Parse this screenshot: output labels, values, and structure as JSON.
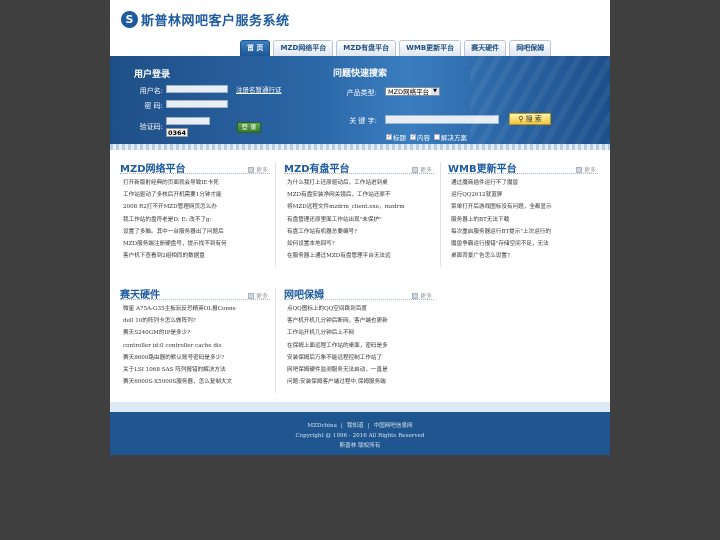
{
  "brand": {
    "logo_glyph": "S",
    "title": "斯普林网吧客户服务系统",
    "color": "#1d5a9e"
  },
  "nav": {
    "tabs": [
      {
        "label": "首 页"
      },
      {
        "label": "MZD网络平台"
      },
      {
        "label": "MZD有盘平台"
      },
      {
        "label": "WMB更新平台"
      },
      {
        "label": "赛天硬件"
      },
      {
        "label": "网吧保姆"
      }
    ],
    "active_index": 0
  },
  "login": {
    "title": "用户登录",
    "username_label": "用户名:",
    "password_label": "密  码:",
    "captcha_label": "验证码:",
    "register_link": "注册名暂通行证",
    "captcha_text": "0364",
    "submit_label": "登 录"
  },
  "quick_search": {
    "title": "问题快速搜索",
    "product_label": "产品类型:",
    "product_selected": "MZD网络平台",
    "keyword_label": "关 键 字:",
    "search_button": "搜 索",
    "options": [
      {
        "label": "标题",
        "checked": true
      },
      {
        "label": "内容",
        "checked": true
      },
      {
        "label": "解决方案",
        "checked": false
      }
    ]
  },
  "sections": [
    {
      "title": "MZD网络平台",
      "more": "更多",
      "items": [
        "打开新版射经典的页面就会导致IE卡死",
        "工作站驱动了多核后开机需要1分钟才能",
        "2008 R2打不开MZD管理网页怎么办",
        "我工作站的盘符老是D: E: 改不了g:",
        "设置了多脑。其中一台服务器出了问题后",
        "MZD服务端注册硬盘号，提示找不到有何",
        "客户机下查看到2组相同的数据盘"
      ]
    },
    {
      "title": "MZD有盘平台",
      "more": "更多",
      "items": [
        "为什么我打上还原驱动后，工作站进到桌",
        "MZD有盘安装净网关镜后，工作站还原不",
        "将MZD远程文件mzdrm_client.exe，mzdrm",
        "有盘管理还原里面工作站出现\"未保护\"",
        "有盘工作站有机器总要编号?",
        "如何设置本地回写?",
        "在服务器上通过MZD有盘管理平台无法远"
      ]
    },
    {
      "title": "WMB更新平台",
      "more": "更多",
      "items": [
        "通过魔商插件运行不了魔兽",
        "运行QQ2012就蓝屏",
        "菜单打开后游戏图标没有问题，全都显示",
        "服务器上的BT无法下载",
        "每次重启服务器运行BT提示\"上次运行的",
        "魔兽争霸运行报错\"存储空间不足，无法",
        "桌面背景广告怎么设置?"
      ]
    },
    {
      "title": "赛天硬件",
      "more": "更多",
      "items": [
        "微星 A75A-G35主板玩反恐精英OL报Conne",
        "dell 10的阵列卡怎么做阵列?",
        "赛天S240GM的IP是多少?",
        "controller id:0 controller cache dis",
        "赛天8600路由器的默认账号密码是多少?",
        "关于LSI 1068 SAS 阵列报错的解决方法",
        "赛天6000S-X5000S服务器，怎么复制大文"
      ]
    },
    {
      "title": "网吧保姆",
      "more": "更多",
      "items": [
        "点QQ图标上的QQ空间跳到百度",
        "客户机开机几分钟后断网，客户端也更新",
        "工作站开机几分钟后上不网",
        "在保姆上面远程工作站的桌面，密码是多",
        "安装保姆后万象不能远程控制工作站了",
        "网吧保姆硬件监测服务无法启动，一直是",
        "问题:安装保姆客户端过程中,保姆服务端"
      ]
    }
  ],
  "footer": {
    "links": [
      "MZDchina",
      "我知道",
      "中国网吧信息网"
    ],
    "copyright": "Copyright @ 1996 - 2016 All Rights Reserved",
    "owner": "斯普林 版权所有"
  }
}
